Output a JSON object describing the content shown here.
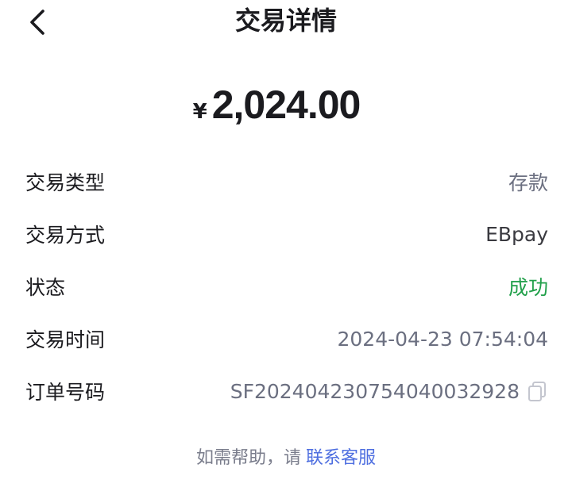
{
  "header": {
    "title": "交易详情",
    "back_icon": "chevron-left-icon"
  },
  "amount": {
    "currency": "¥",
    "value": "2,024.00"
  },
  "details": [
    {
      "label": "交易类型",
      "value": "存款"
    },
    {
      "label": "交易方式",
      "value": "EBpay"
    },
    {
      "label": "状态",
      "value": "成功"
    },
    {
      "label": "交易时间",
      "value": "2024-04-23 07:54:04"
    },
    {
      "label": "订单号码",
      "value": "SF202404230754040032928"
    }
  ],
  "colors": {
    "success": "#22a04b",
    "link": "#4f6fe0",
    "muted": "#6b6f80"
  },
  "help": {
    "prefix": "如需帮助，请",
    "link": "联系客服"
  }
}
